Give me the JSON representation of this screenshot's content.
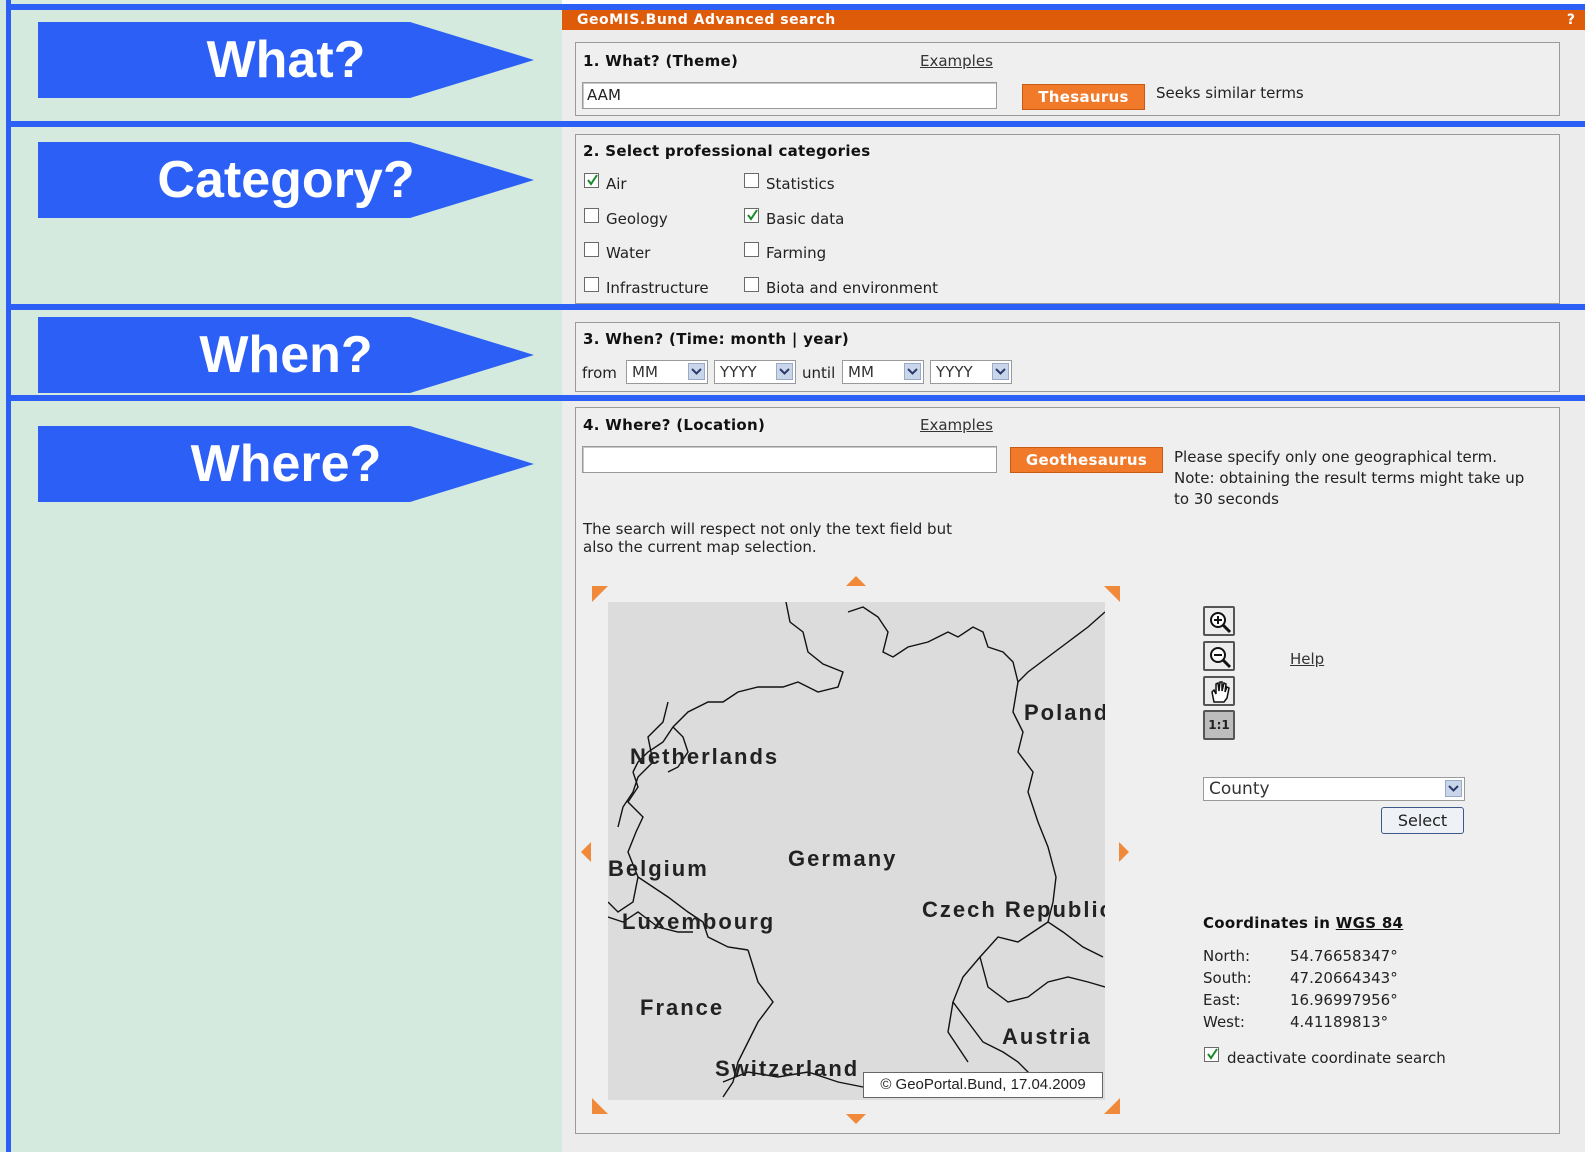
{
  "labels": {
    "what": "What?",
    "category": "Category?",
    "when": "When?",
    "where": "Where?"
  },
  "titlebar": {
    "title": "GeoMIS.Bund Advanced search",
    "help": "?"
  },
  "what": {
    "heading": "1. What? (Theme)",
    "examples_link": "Examples",
    "input_value": "AAM",
    "thesaurus_button": "Thesaurus",
    "thesaurus_hint": "Seeks similar terms"
  },
  "categories": {
    "heading": "2. Select professional categories",
    "items": [
      {
        "label": "Air",
        "checked": true
      },
      {
        "label": "Statistics",
        "checked": false
      },
      {
        "label": "Geology",
        "checked": false
      },
      {
        "label": "Basic data",
        "checked": true
      },
      {
        "label": "Water",
        "checked": false
      },
      {
        "label": "Farming",
        "checked": false
      },
      {
        "label": "Infrastructure",
        "checked": false
      },
      {
        "label": "Biota and environment",
        "checked": false
      }
    ]
  },
  "when": {
    "heading": "3. When? (Time: month | year)",
    "from_label": "from",
    "until_label": "until",
    "from_month": "MM",
    "from_year": "YYYY",
    "until_month": "MM",
    "until_year": "YYYY"
  },
  "where": {
    "heading": "4. Where? (Location)",
    "examples_link": "Examples",
    "input_value": "",
    "geothesaurus_button": "Geothesaurus",
    "hint_line1": "Please specify only one geographical term.",
    "hint_line2": "Note: obtaining the result terms might take up",
    "hint_line3": "to 30 seconds",
    "note_line1": "The search will respect not only the text field but",
    "note_line2": "also the current map selection."
  },
  "map": {
    "labels": {
      "netherlands": "Netherlands",
      "poland": "Poland",
      "belgium": "Belgium",
      "germany": "Germany",
      "luxembourg": "Luxembourg",
      "czech": "Czech Republic",
      "france": "France",
      "austria": "Austria",
      "switzerland": "Switzerland"
    },
    "copyright": "© GeoPortal.Bund, 17.04.2009"
  },
  "tools": {
    "zoom_in": "zoom-in-icon",
    "zoom_out": "zoom-out-icon",
    "pan": "pan-hand-icon",
    "reset": "1:1",
    "help_link": "Help"
  },
  "region": {
    "select_value": "County",
    "select_button": "Select"
  },
  "coordinates": {
    "heading_prefix": "Coordinates in ",
    "heading_link": "WGS 84",
    "rows": [
      {
        "key": "North:",
        "value": "54.76658347°"
      },
      {
        "key": "South:",
        "value": "47.20664343°"
      },
      {
        "key": "East:",
        "value": "16.96997956°"
      },
      {
        "key": "West:",
        "value": "4.41189813°"
      }
    ],
    "deactivate_label": "deactivate coordinate search",
    "deactivate_checked": true
  },
  "colors": {
    "accent_blue": "#2b5ff5",
    "orange": "#de5b0a",
    "left_bg": "#d4eadf"
  }
}
